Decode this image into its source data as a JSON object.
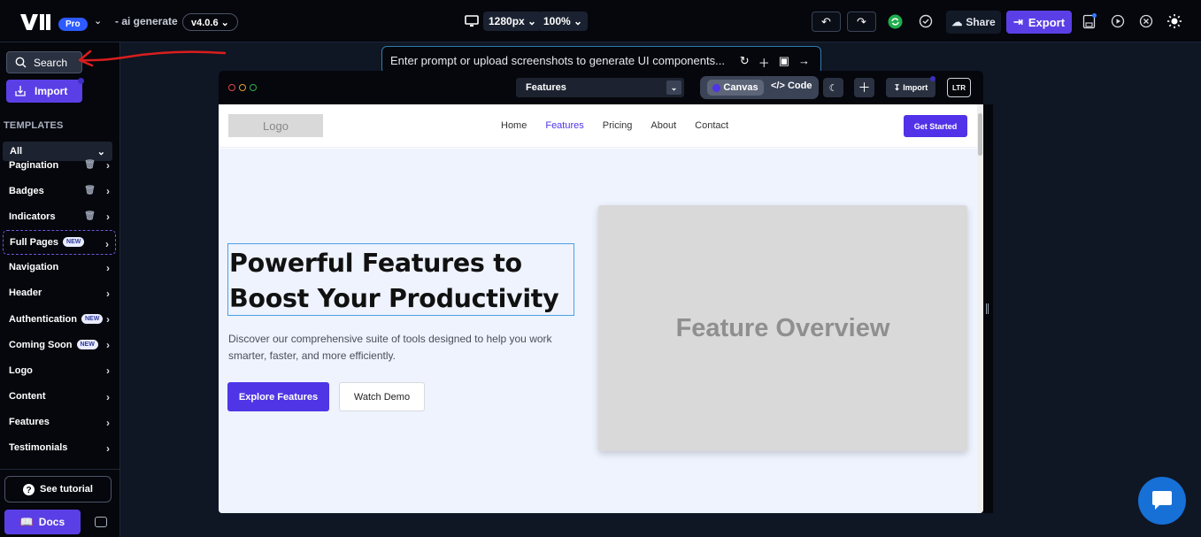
{
  "topbar": {
    "pro_badge": "Pro",
    "ai_generate": "- ai generate",
    "version": "v4.0.6",
    "viewport": "1280px",
    "zoom": "100%",
    "share_label": "Share",
    "export_label": "Export"
  },
  "sidebar": {
    "search_label": "Search",
    "import_label": "Import",
    "templates_heading": "TEMPLATES",
    "filter_value": "All",
    "items": [
      {
        "label": "Pagination",
        "badge": "",
        "trash": true
      },
      {
        "label": "Badges",
        "badge": "",
        "trash": true
      },
      {
        "label": "Indicators",
        "badge": "",
        "trash": true
      },
      {
        "label": "Full Pages",
        "badge": "NEW",
        "trash": false
      },
      {
        "label": "Navigation",
        "badge": "",
        "trash": false
      },
      {
        "label": "Header",
        "badge": "",
        "trash": false
      },
      {
        "label": "Authentication",
        "badge": "NEW",
        "trash": false
      },
      {
        "label": "Coming Soon",
        "badge": "NEW",
        "trash": false
      },
      {
        "label": "Logo",
        "badge": "",
        "trash": false
      },
      {
        "label": "Content",
        "badge": "",
        "trash": false
      },
      {
        "label": "Features",
        "badge": "",
        "trash": false
      },
      {
        "label": "Testimonials",
        "badge": "",
        "trash": false
      }
    ],
    "tutorial_label": "See tutorial",
    "docs_label": "Docs"
  },
  "prompt": {
    "placeholder": "Enter prompt or upload screenshots to generate UI components..."
  },
  "canvas_window": {
    "page_select": "Features",
    "mode_canvas": "Canvas",
    "mode_code": "Code",
    "import_label": "Import",
    "direction": "LTR"
  },
  "preview": {
    "logo": "Logo",
    "nav_links": [
      "Home",
      "Features",
      "Pricing",
      "About",
      "Contact"
    ],
    "active_link": "Features",
    "cta": "Get Started",
    "hero_title_line1": "Powerful Features to",
    "hero_title_line2": "Boost Your Productivity",
    "hero_sub_line1": "Discover our comprehensive suite of tools designed to help you work",
    "hero_sub_line2": "smarter, faster, and more efficiently.",
    "btn_primary": "Explore Features",
    "btn_secondary": "Watch Demo",
    "image_caption": "Feature Overview"
  },
  "colors": {
    "accent": "#5b3fe6",
    "pro_blue": "#2d5bff",
    "annotation_red": "#d91e1e",
    "chat_fab": "#1670d6"
  }
}
